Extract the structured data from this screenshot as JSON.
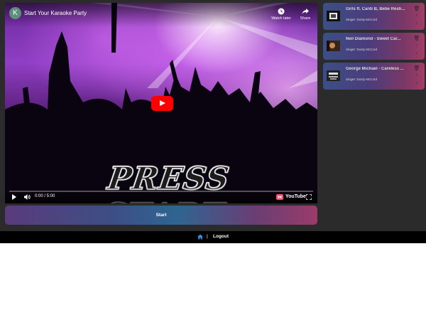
{
  "player": {
    "channel_initial": "K",
    "title": "Start Your Karaoke Party",
    "watch_later": "Watch later",
    "share": "Share",
    "overlay_text": "PRESS START",
    "time": "0:00 / 5:00",
    "progress": 0.0,
    "brand": "YouTube"
  },
  "start_button": "Start",
  "queue": [
    {
      "title": "Girls ft. Cardi B, Bebe Resh...",
      "singer": "Singer: Dusty McCord"
    },
    {
      "title": "Neil Diamond - Sweet Car...",
      "singer": "Singer: Dusty McCord"
    },
    {
      "title": "George Michael - Careless ...",
      "singer": "Singer: Dusty McCord"
    }
  ],
  "footer": {
    "separator": "|",
    "logout": "Logout"
  },
  "colors": {
    "app_bg": "#2b2b2b",
    "youtube_red": "#ff0000",
    "home_icon": "#3b8fe0",
    "footer_bg": "#000000"
  }
}
